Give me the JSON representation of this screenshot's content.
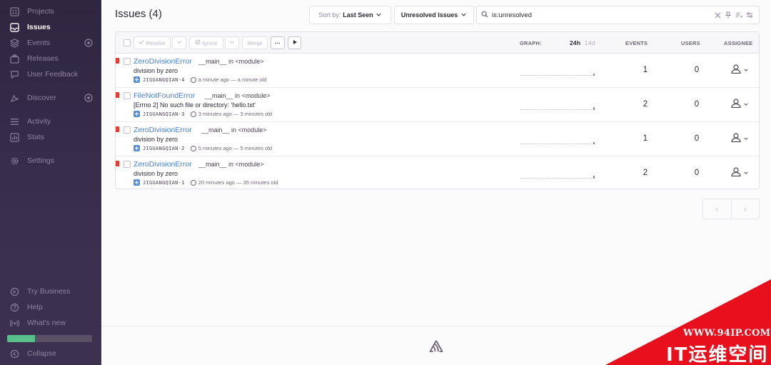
{
  "sidebar": {
    "items": [
      {
        "label": "Projects",
        "icon": "projects-icon"
      },
      {
        "label": "Issues",
        "icon": "issues-icon",
        "active": true
      },
      {
        "label": "Events",
        "icon": "events-icon"
      },
      {
        "label": "Releases",
        "icon": "releases-icon"
      },
      {
        "label": "User Feedback",
        "icon": "user-feedback-icon"
      },
      {
        "label": "Discover",
        "icon": "discover-icon"
      },
      {
        "label": "Activity",
        "icon": "activity-icon"
      },
      {
        "label": "Stats",
        "icon": "stats-icon"
      },
      {
        "label": "Settings",
        "icon": "settings-icon"
      }
    ],
    "bottom_items": [
      {
        "label": "Try Business",
        "icon": "try-business-icon"
      },
      {
        "label": "Help",
        "icon": "help-icon"
      },
      {
        "label": "What's new",
        "icon": "broadcast-icon"
      },
      {
        "label": "Collapse",
        "icon": "collapse-icon"
      }
    ],
    "trial_progress": 0.33
  },
  "header": {
    "title": "Issues (4)",
    "sort_prefix": "Sort by:",
    "sort_value": "Last Seen",
    "filter_label": "Unresolved Issues",
    "search_value": "is:unresolved"
  },
  "toolbar": {
    "resolve": "Resolve",
    "ignore": "Ignore",
    "merge": "Merge",
    "more": "···"
  },
  "columns": {
    "graph": "GRAPH:",
    "period_24h": "24h",
    "period_14d": "14d",
    "events": "EVENTS",
    "users": "USERS",
    "assignee": "ASSIGNEE"
  },
  "issues": [
    {
      "type": "ZeroDivisionError",
      "location": "__main__ in <module>",
      "message": "division by zero",
      "project": "JIGUANGQIAN-4",
      "time": "a minute ago — a minute old",
      "events": "1",
      "users": "0"
    },
    {
      "type": "FileNotFoundError",
      "location": "__main__ in <module>",
      "message": "[Errno 2] No such file or directory: 'hello.txt'",
      "project": "JIGUANGQIAN-3",
      "time": "3 minutes ago — 3 minutes old",
      "events": "2",
      "users": "0"
    },
    {
      "type": "ZeroDivisionError",
      "location": "__main__ in <module>",
      "message": "division by zero",
      "project": "JIGUANGQIAN-2",
      "time": "5 minutes ago — 5 minutes old",
      "events": "1",
      "users": "0"
    },
    {
      "type": "ZeroDivisionError",
      "location": "__main__ in <module>",
      "message": "division by zero",
      "project": "JIGUANGQIAN-1",
      "time": "20 minutes ago — 35 minutes old",
      "events": "2",
      "users": "0"
    }
  ],
  "pager": {
    "prev": "‹",
    "next": "›"
  },
  "watermark": {
    "url": "WWW.94IP.COM",
    "name": "IT运维空间"
  },
  "colors": {
    "sidebar": "#2f2640",
    "link": "#4a7fd0",
    "error": "#e03e2f",
    "progress": "#57be8c",
    "watermark": "#e8101c"
  }
}
